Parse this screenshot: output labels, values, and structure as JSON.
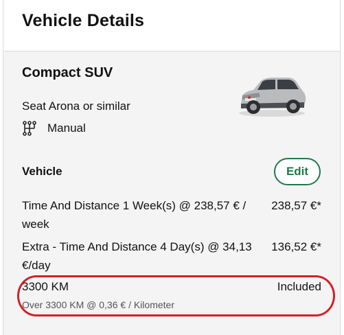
{
  "header": {
    "title": "Vehicle Details"
  },
  "vehicle": {
    "category": "Compact SUV",
    "model": "Seat Arona or similar",
    "transmission": "Manual",
    "transmission_icon": "gearshift-icon",
    "image_icon": "car-image"
  },
  "section": {
    "title": "Vehicle",
    "edit_label": "Edit"
  },
  "line_items": [
    {
      "label": "Time And Distance 1 Week(s) @ 238,57 € / week",
      "price": "238,57 €*"
    },
    {
      "label": "Extra - Time And Distance 4 Day(s) @ 34,13 €/day",
      "price": "136,52 €*"
    }
  ],
  "mileage": {
    "label": "3300 KM",
    "status": "Included",
    "note": "Over 3300 KM @ 0,36 € / Kilometer"
  },
  "colors": {
    "accent": "#1f7a4a",
    "highlight": "#d42027",
    "card_bg": "#f4f4f4"
  }
}
